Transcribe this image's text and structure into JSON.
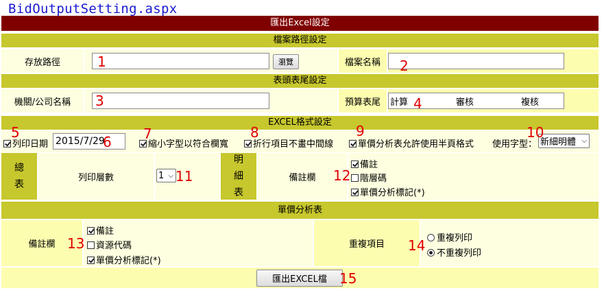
{
  "page_title": "BidOutputSetting.aspx",
  "header": {
    "title": "匯出Excel設定"
  },
  "file_path_section": {
    "title": "檔案路徑設定",
    "storage_path_label": "存放路徑",
    "storage_path_value": "",
    "browse_button": "瀏覽",
    "file_name_label": "檔案名稱",
    "file_name_value": ""
  },
  "header_footer_section": {
    "title": "表頭表尾設定",
    "org_name_label": "機關/公司名稱",
    "org_name_value": "",
    "budget_footer_label": "預算表尾",
    "budget_footer_items": [
      "計算",
      "審核",
      "複核"
    ]
  },
  "format_section": {
    "title": "EXCEL格式設定",
    "print_date_label": "列印日期",
    "print_date_value": "2015/7/29",
    "shrink_font_label": "縮小字型以符合欄寬",
    "no_midline_label": "折行項目不畫中間線",
    "half_page_label": "單價分析表允許使用半頁格式",
    "font_label": "使用字型：",
    "font_value": "新細明體"
  },
  "summary_table": {
    "label": "總表",
    "print_levels_label": "列印層數",
    "print_levels_value": "1"
  },
  "detail_table": {
    "label": "明細表",
    "remarks_label": "備註欄",
    "options": [
      "備註",
      "階層碼",
      "單價分析標記(*)"
    ]
  },
  "unit_price_section": {
    "title": "單價分析表",
    "remarks_label": "備註欄",
    "options": [
      "備註",
      "資源代碼",
      "單價分析標記(*)"
    ],
    "repeat_label": "重複項目",
    "repeat_options": [
      "重複列印",
      "不重複列印"
    ]
  },
  "export_button": "匯出EXCEL檔",
  "annotations": [
    "1",
    "2",
    "3",
    "4",
    "5",
    "6",
    "7",
    "8",
    "9",
    "10",
    "11",
    "12",
    "13",
    "14",
    "15"
  ],
  "colors": {
    "header_red": "#800000",
    "section_olive": "#c7c72e",
    "cell_light": "#fefee0",
    "cell_mid": "#fdfdb0",
    "annotation_red": "#e00000"
  }
}
